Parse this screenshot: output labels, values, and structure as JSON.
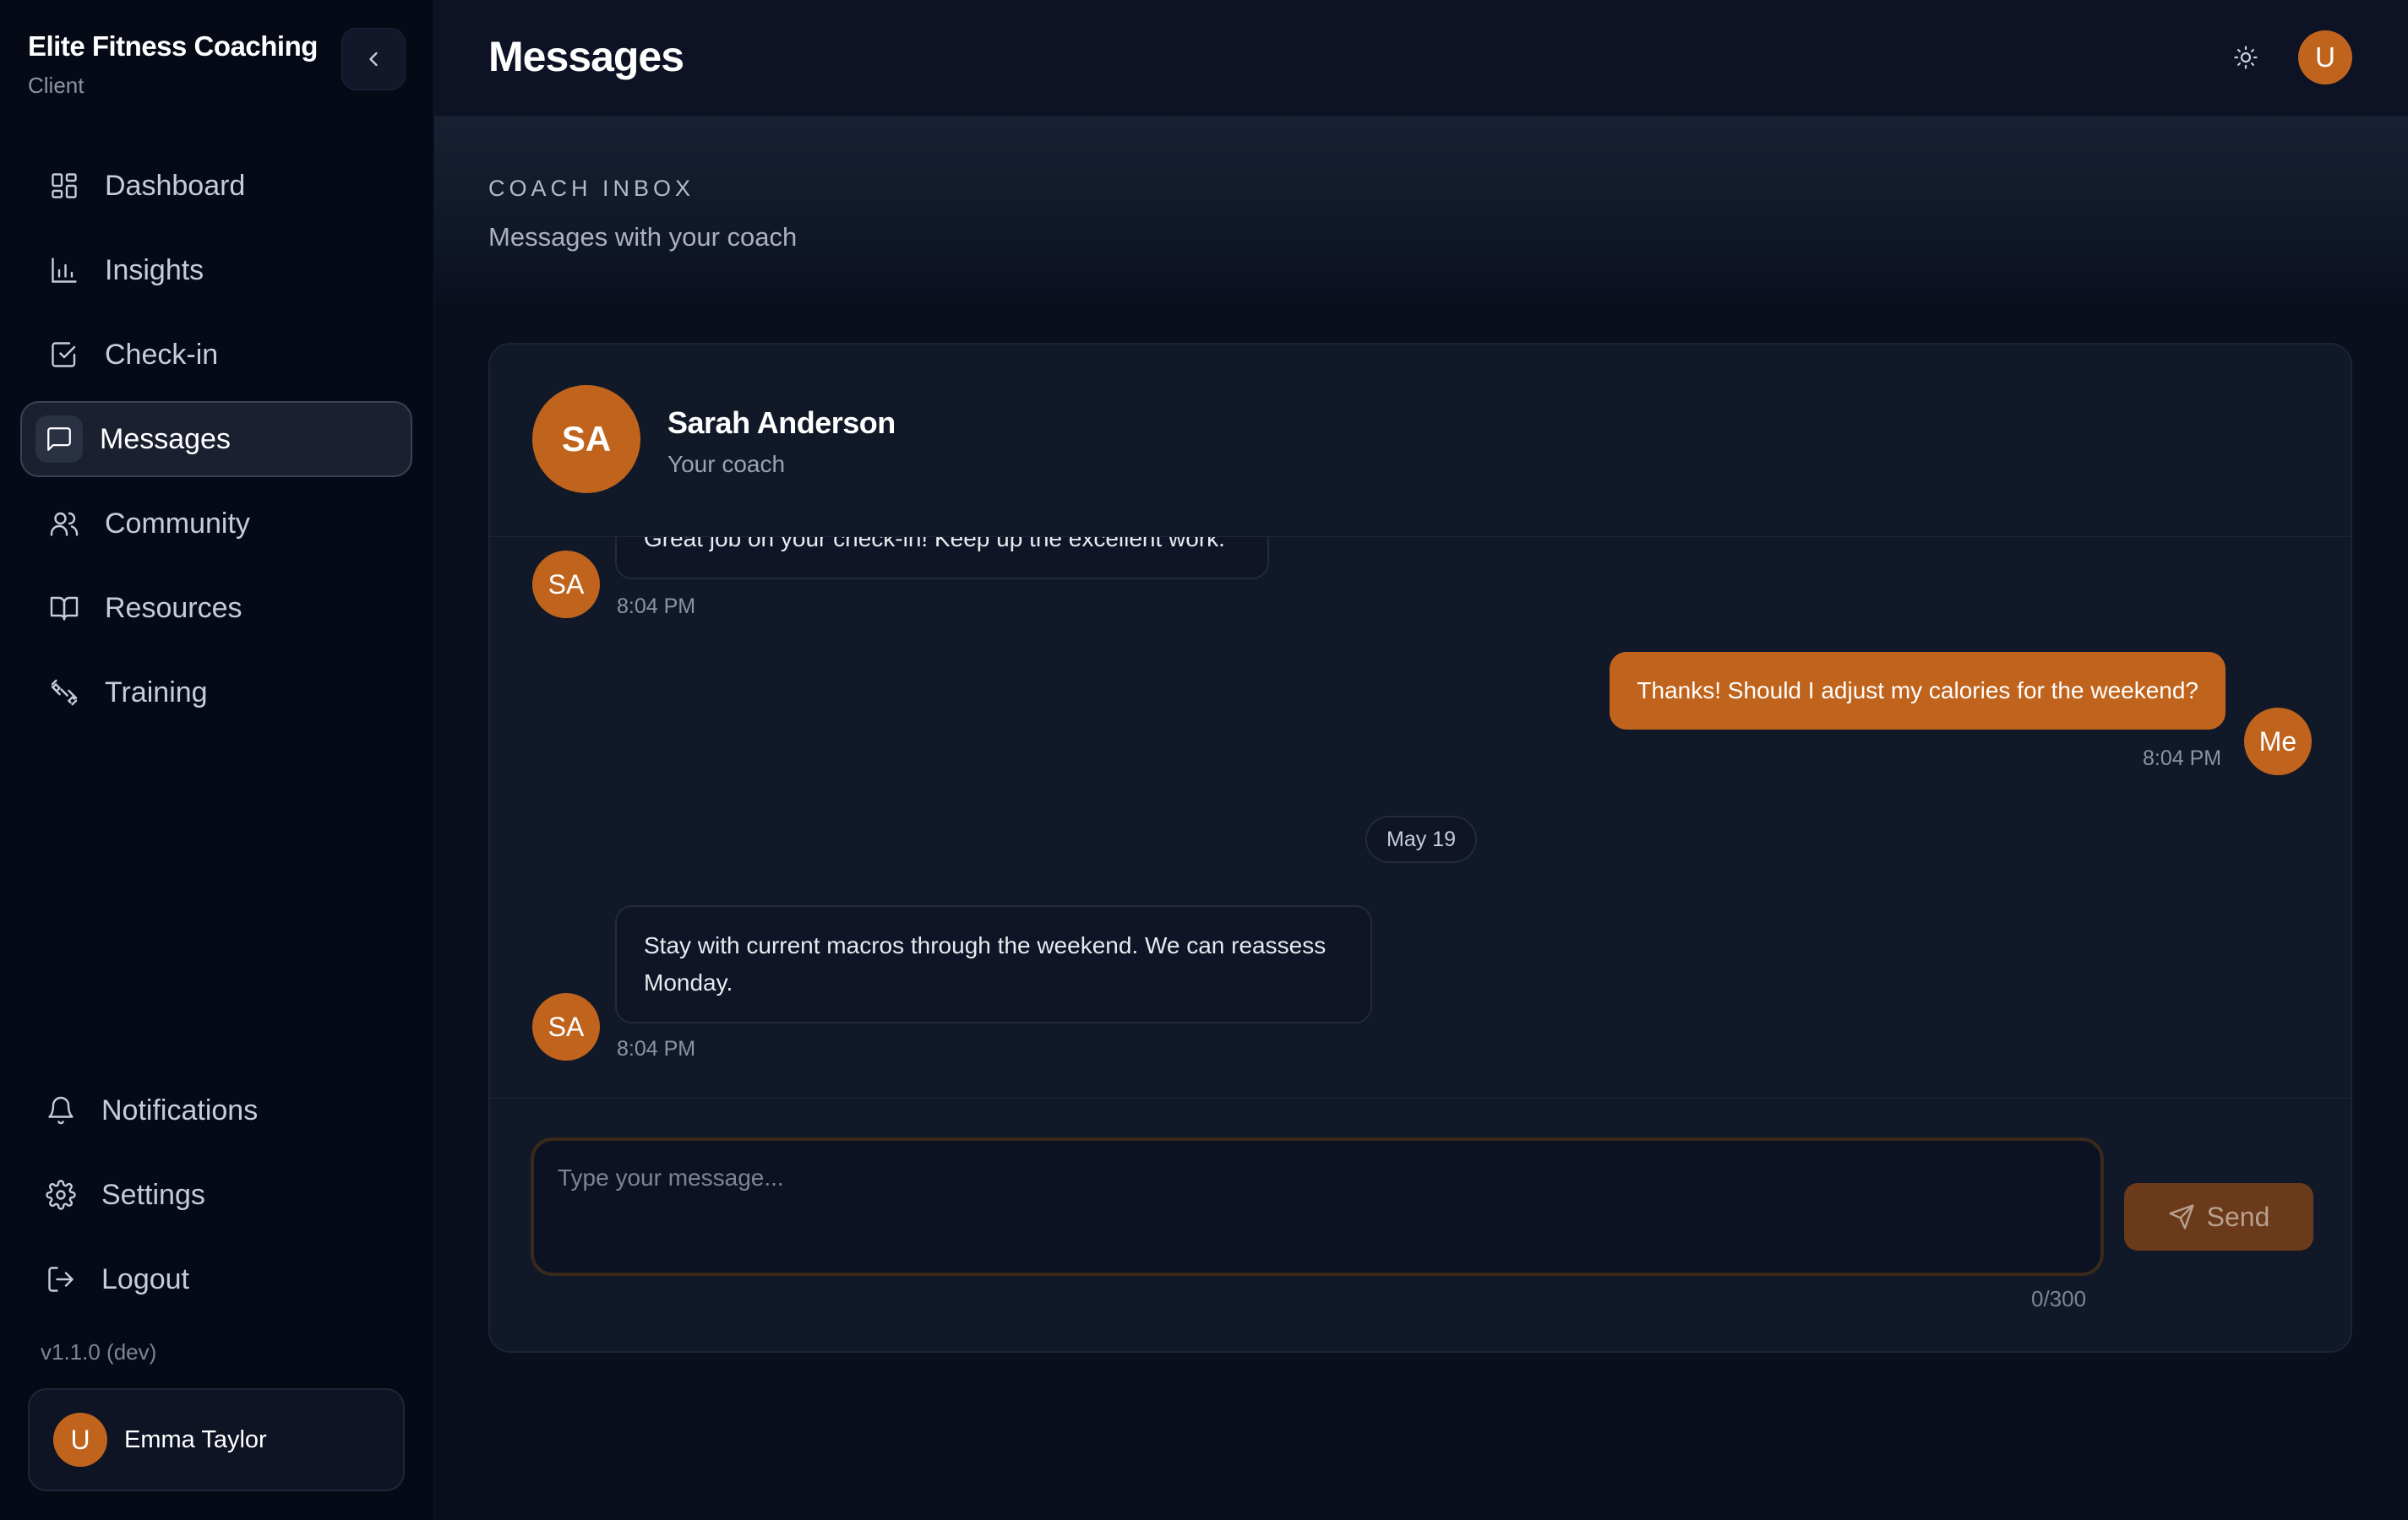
{
  "brand": {
    "title": "Elite Fitness Coaching",
    "role": "Client"
  },
  "nav": {
    "items": [
      {
        "label": "Dashboard",
        "icon": "dashboard-icon"
      },
      {
        "label": "Insights",
        "icon": "bar-chart-icon"
      },
      {
        "label": "Check-in",
        "icon": "checkbox-icon"
      },
      {
        "label": "Messages",
        "icon": "message-icon",
        "active": true
      },
      {
        "label": "Community",
        "icon": "users-icon"
      },
      {
        "label": "Resources",
        "icon": "book-icon"
      },
      {
        "label": "Training",
        "icon": "dumbbell-icon"
      }
    ],
    "bottom": [
      {
        "label": "Notifications",
        "icon": "bell-icon"
      },
      {
        "label": "Settings",
        "icon": "gear-icon"
      },
      {
        "label": "Logout",
        "icon": "logout-icon"
      }
    ]
  },
  "version": "v1.1.0 (dev)",
  "user": {
    "initial": "U",
    "name": "Emma Taylor"
  },
  "header": {
    "title": "Messages",
    "avatar_initial": "U"
  },
  "hero": {
    "eyebrow": "COACH INBOX",
    "subtitle": "Messages with your coach"
  },
  "coach": {
    "initials": "SA",
    "name": "Sarah Anderson",
    "role": "Your coach"
  },
  "messages": [
    {
      "from": "coach",
      "initials": "SA",
      "text": "Great job on your check-in! Keep up the excellent work.",
      "time": "8:04 PM"
    },
    {
      "from": "me",
      "initials": "Me",
      "text": "Thanks! Should I adjust my calories for the weekend?",
      "time": "8:04 PM"
    },
    {
      "date_divider": "May 19"
    },
    {
      "from": "coach",
      "initials": "SA",
      "text": "Stay with current macros through the weekend. We can reassess Monday.",
      "time": "8:04 PM"
    }
  ],
  "composer": {
    "placeholder": "Type your message...",
    "counter": "0/300",
    "send_label": "Send"
  },
  "colors": {
    "accent": "#c0641d",
    "background": "#0a0f1e",
    "sidebar": "#060a17"
  }
}
